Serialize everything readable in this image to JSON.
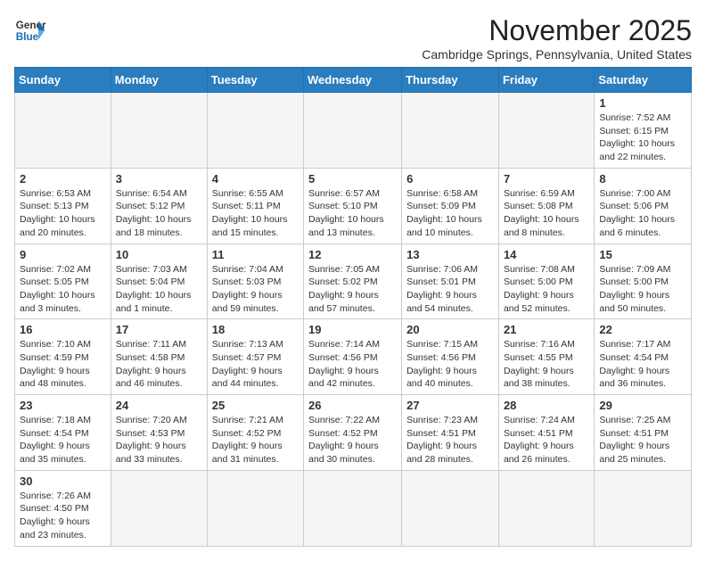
{
  "header": {
    "logo_general": "General",
    "logo_blue": "Blue",
    "month_title": "November 2025",
    "location": "Cambridge Springs, Pennsylvania, United States"
  },
  "weekdays": [
    "Sunday",
    "Monday",
    "Tuesday",
    "Wednesday",
    "Thursday",
    "Friday",
    "Saturday"
  ],
  "weeks": [
    [
      {
        "day": "",
        "info": ""
      },
      {
        "day": "",
        "info": ""
      },
      {
        "day": "",
        "info": ""
      },
      {
        "day": "",
        "info": ""
      },
      {
        "day": "",
        "info": ""
      },
      {
        "day": "",
        "info": ""
      },
      {
        "day": "1",
        "info": "Sunrise: 7:52 AM\nSunset: 6:15 PM\nDaylight: 10 hours and 22 minutes."
      }
    ],
    [
      {
        "day": "2",
        "info": "Sunrise: 6:53 AM\nSunset: 5:13 PM\nDaylight: 10 hours and 20 minutes."
      },
      {
        "day": "3",
        "info": "Sunrise: 6:54 AM\nSunset: 5:12 PM\nDaylight: 10 hours and 18 minutes."
      },
      {
        "day": "4",
        "info": "Sunrise: 6:55 AM\nSunset: 5:11 PM\nDaylight: 10 hours and 15 minutes."
      },
      {
        "day": "5",
        "info": "Sunrise: 6:57 AM\nSunset: 5:10 PM\nDaylight: 10 hours and 13 minutes."
      },
      {
        "day": "6",
        "info": "Sunrise: 6:58 AM\nSunset: 5:09 PM\nDaylight: 10 hours and 10 minutes."
      },
      {
        "day": "7",
        "info": "Sunrise: 6:59 AM\nSunset: 5:08 PM\nDaylight: 10 hours and 8 minutes."
      },
      {
        "day": "8",
        "info": "Sunrise: 7:00 AM\nSunset: 5:06 PM\nDaylight: 10 hours and 6 minutes."
      }
    ],
    [
      {
        "day": "9",
        "info": "Sunrise: 7:02 AM\nSunset: 5:05 PM\nDaylight: 10 hours and 3 minutes."
      },
      {
        "day": "10",
        "info": "Sunrise: 7:03 AM\nSunset: 5:04 PM\nDaylight: 10 hours and 1 minute."
      },
      {
        "day": "11",
        "info": "Sunrise: 7:04 AM\nSunset: 5:03 PM\nDaylight: 9 hours and 59 minutes."
      },
      {
        "day": "12",
        "info": "Sunrise: 7:05 AM\nSunset: 5:02 PM\nDaylight: 9 hours and 57 minutes."
      },
      {
        "day": "13",
        "info": "Sunrise: 7:06 AM\nSunset: 5:01 PM\nDaylight: 9 hours and 54 minutes."
      },
      {
        "day": "14",
        "info": "Sunrise: 7:08 AM\nSunset: 5:00 PM\nDaylight: 9 hours and 52 minutes."
      },
      {
        "day": "15",
        "info": "Sunrise: 7:09 AM\nSunset: 5:00 PM\nDaylight: 9 hours and 50 minutes."
      }
    ],
    [
      {
        "day": "16",
        "info": "Sunrise: 7:10 AM\nSunset: 4:59 PM\nDaylight: 9 hours and 48 minutes."
      },
      {
        "day": "17",
        "info": "Sunrise: 7:11 AM\nSunset: 4:58 PM\nDaylight: 9 hours and 46 minutes."
      },
      {
        "day": "18",
        "info": "Sunrise: 7:13 AM\nSunset: 4:57 PM\nDaylight: 9 hours and 44 minutes."
      },
      {
        "day": "19",
        "info": "Sunrise: 7:14 AM\nSunset: 4:56 PM\nDaylight: 9 hours and 42 minutes."
      },
      {
        "day": "20",
        "info": "Sunrise: 7:15 AM\nSunset: 4:56 PM\nDaylight: 9 hours and 40 minutes."
      },
      {
        "day": "21",
        "info": "Sunrise: 7:16 AM\nSunset: 4:55 PM\nDaylight: 9 hours and 38 minutes."
      },
      {
        "day": "22",
        "info": "Sunrise: 7:17 AM\nSunset: 4:54 PM\nDaylight: 9 hours and 36 minutes."
      }
    ],
    [
      {
        "day": "23",
        "info": "Sunrise: 7:18 AM\nSunset: 4:54 PM\nDaylight: 9 hours and 35 minutes."
      },
      {
        "day": "24",
        "info": "Sunrise: 7:20 AM\nSunset: 4:53 PM\nDaylight: 9 hours and 33 minutes."
      },
      {
        "day": "25",
        "info": "Sunrise: 7:21 AM\nSunset: 4:52 PM\nDaylight: 9 hours and 31 minutes."
      },
      {
        "day": "26",
        "info": "Sunrise: 7:22 AM\nSunset: 4:52 PM\nDaylight: 9 hours and 30 minutes."
      },
      {
        "day": "27",
        "info": "Sunrise: 7:23 AM\nSunset: 4:51 PM\nDaylight: 9 hours and 28 minutes."
      },
      {
        "day": "28",
        "info": "Sunrise: 7:24 AM\nSunset: 4:51 PM\nDaylight: 9 hours and 26 minutes."
      },
      {
        "day": "29",
        "info": "Sunrise: 7:25 AM\nSunset: 4:51 PM\nDaylight: 9 hours and 25 minutes."
      }
    ],
    [
      {
        "day": "30",
        "info": "Sunrise: 7:26 AM\nSunset: 4:50 PM\nDaylight: 9 hours and 23 minutes."
      },
      {
        "day": "",
        "info": ""
      },
      {
        "day": "",
        "info": ""
      },
      {
        "day": "",
        "info": ""
      },
      {
        "day": "",
        "info": ""
      },
      {
        "day": "",
        "info": ""
      },
      {
        "day": "",
        "info": ""
      }
    ]
  ]
}
